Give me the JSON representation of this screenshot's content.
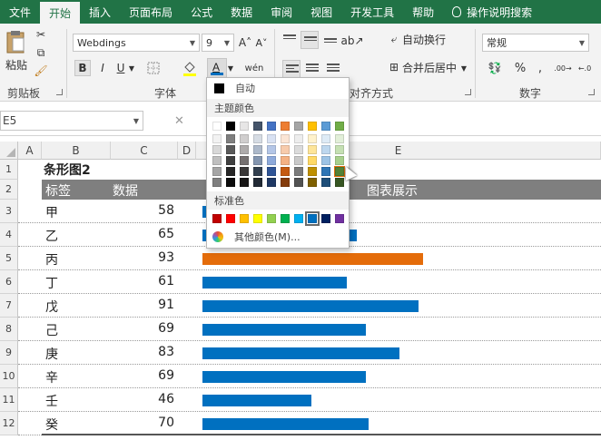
{
  "tabs": [
    {
      "label": "文件",
      "active": false
    },
    {
      "label": "开始",
      "active": true
    },
    {
      "label": "插入",
      "active": false
    },
    {
      "label": "页面布局",
      "active": false
    },
    {
      "label": "公式",
      "active": false
    },
    {
      "label": "数据",
      "active": false
    },
    {
      "label": "审阅",
      "active": false
    },
    {
      "label": "视图",
      "active": false
    },
    {
      "label": "开发工具",
      "active": false
    },
    {
      "label": "帮助",
      "active": false
    }
  ],
  "tell_me": "操作说明搜索",
  "ribbon": {
    "clipboard": {
      "label": "剪贴板",
      "paste": "粘贴"
    },
    "font": {
      "label": "字体",
      "font_name": "Webdings",
      "font_size": "9"
    },
    "alignment": {
      "label": "对齐方式",
      "wrap_text": "自动换行",
      "merge_center": "合并后居中"
    },
    "number": {
      "label": "数字",
      "format": "常规"
    }
  },
  "formula_bar": {
    "name_box": "E5",
    "fx_cancel": "✕"
  },
  "sheet": {
    "columns": [
      "A",
      "B",
      "C",
      "D",
      "E"
    ],
    "rows": [
      "1",
      "2",
      "3",
      "4",
      "5",
      "6",
      "7",
      "8",
      "9",
      "10",
      "11",
      "12"
    ],
    "title": "条形图2",
    "headers": {
      "label": "标签",
      "value": "数据",
      "chart": "图表展示"
    },
    "data": [
      {
        "label": "甲",
        "value": 58,
        "bar_color": "#0070c0"
      },
      {
        "label": "乙",
        "value": 65,
        "bar_color": "#0070c0"
      },
      {
        "label": "丙",
        "value": 93,
        "bar_color": "#e46c0a"
      },
      {
        "label": "丁",
        "value": 61,
        "bar_color": "#0070c0"
      },
      {
        "label": "戊",
        "value": 91,
        "bar_color": "#0070c0"
      },
      {
        "label": "己",
        "value": 69,
        "bar_color": "#0070c0"
      },
      {
        "label": "庚",
        "value": 83,
        "bar_color": "#0070c0"
      },
      {
        "label": "辛",
        "value": 69,
        "bar_color": "#0070c0"
      },
      {
        "label": "壬",
        "value": 46,
        "bar_color": "#0070c0"
      },
      {
        "label": "癸",
        "value": 70,
        "bar_color": "#0070c0"
      }
    ]
  },
  "color_dropdown": {
    "automatic": "自动",
    "theme_colors_title": "主题颜色",
    "standard_colors_title": "标准色",
    "more_colors": "其他颜色(M)...",
    "theme_colors": [
      [
        "#ffffff",
        "#000000",
        "#e7e6e6",
        "#44546a",
        "#4472c4",
        "#ed7d31",
        "#a5a5a5",
        "#ffc000",
        "#5b9bd5",
        "#70ad47"
      ],
      [
        "#f2f2f2",
        "#7f7f7f",
        "#d0cece",
        "#d6dce4",
        "#d9e2f3",
        "#fbe5d5",
        "#ededed",
        "#fff2cc",
        "#deebf6",
        "#e2efd9"
      ],
      [
        "#d8d8d8",
        "#595959",
        "#aeabab",
        "#adb9ca",
        "#b4c6e7",
        "#f7cbac",
        "#dbdbdb",
        "#fee599",
        "#bdd7ee",
        "#c5e0b3"
      ],
      [
        "#bfbfbf",
        "#3f3f3f",
        "#757070",
        "#8496b0",
        "#8eaadb",
        "#f4b183",
        "#c9c9c9",
        "#ffd965",
        "#9cc3e5",
        "#a8d08d"
      ],
      [
        "#a5a5a5",
        "#262626",
        "#3a3838",
        "#323f4f",
        "#2f5496",
        "#c55a11",
        "#7b7b7b",
        "#bf9000",
        "#2e75b5",
        "#538135"
      ],
      [
        "#7f7f7f",
        "#0c0c0c",
        "#171616",
        "#222a35",
        "#1f3864",
        "#843c0b",
        "#525252",
        "#7f6000",
        "#1e4e79",
        "#375623"
      ]
    ],
    "standard_colors": [
      "#c00000",
      "#ff0000",
      "#ffc000",
      "#ffff00",
      "#92d050",
      "#00b050",
      "#00b0f0",
      "#0070c0",
      "#002060",
      "#7030a0"
    ]
  }
}
